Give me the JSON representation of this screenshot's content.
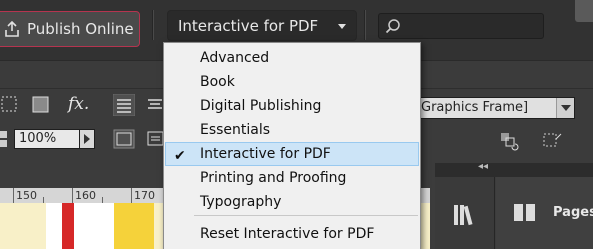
{
  "toolbar": {
    "publish_label": "Publish Online",
    "workspace_label": "Interactive for PDF",
    "search_value": ""
  },
  "control_bar": {
    "zoom_value": "100%",
    "frame_select_value": "Graphics Frame]",
    "fx_label": "fx."
  },
  "ruler": {
    "labels": [
      "150",
      "160",
      "170"
    ]
  },
  "panels": {
    "pages_label": "Pages"
  },
  "menu": {
    "items": [
      {
        "label": "Advanced",
        "checked": false
      },
      {
        "label": "Book",
        "checked": false
      },
      {
        "label": "Digital Publishing",
        "checked": false
      },
      {
        "label": "Essentials",
        "checked": false
      },
      {
        "label": "Interactive for PDF",
        "checked": true
      },
      {
        "label": "Printing and Proofing",
        "checked": false
      },
      {
        "label": "Typography",
        "checked": false
      }
    ],
    "reset_label": "Reset Interactive for PDF"
  },
  "colors": {
    "accent_border": "#b5344f",
    "menu_selected": "#cce4f7",
    "app_bg": "#323232"
  }
}
